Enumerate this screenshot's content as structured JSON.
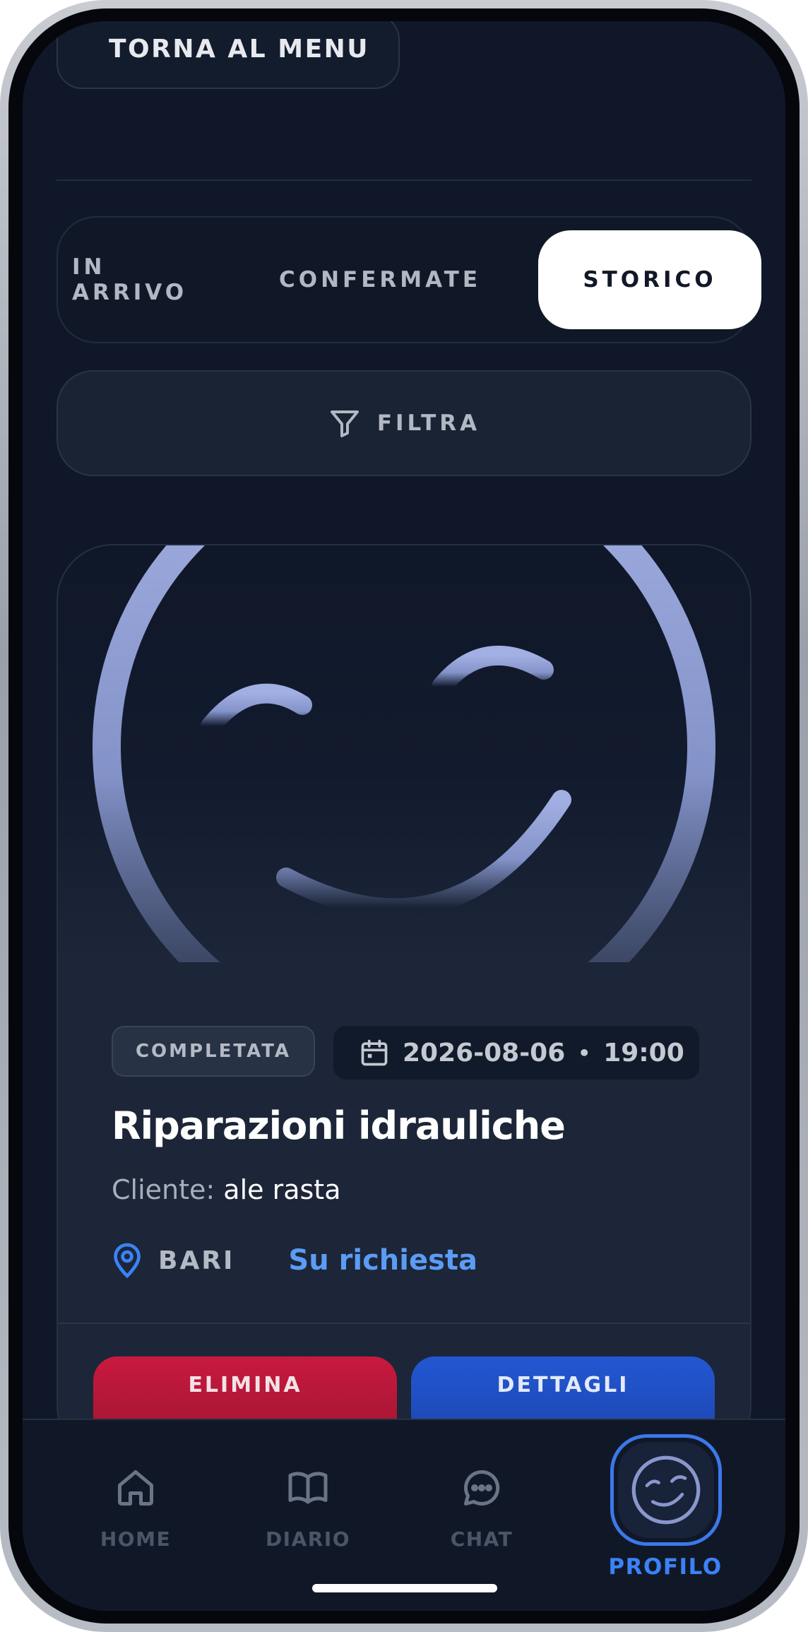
{
  "header": {
    "back_label": "TORNA AL MENU"
  },
  "tabs": [
    {
      "label": "IN ARRIVO",
      "active": false
    },
    {
      "label": "CONFERMATE",
      "active": false
    },
    {
      "label": "STORICO",
      "active": true
    }
  ],
  "filter": {
    "label": "FILTRA",
    "icon": "filter-icon"
  },
  "card": {
    "status": "COMPLETATA",
    "date": "2026-08-06",
    "time": "19:00",
    "separator": "•",
    "title": "Riparazioni idrauliche",
    "client_label": "Cliente:",
    "client_name": "ale rasta",
    "city": "BARI",
    "price_label": "Su richiesta",
    "delete_label": "ELIMINA",
    "details_label": "DETTAGLI"
  },
  "nav": {
    "items": [
      {
        "label": "HOME",
        "icon": "home-icon"
      },
      {
        "label": "DIARIO",
        "icon": "book-icon"
      },
      {
        "label": "CHAT",
        "icon": "chat-icon"
      },
      {
        "label": "PROFILO",
        "icon": "smiley-icon",
        "active": true
      }
    ]
  },
  "colors": {
    "background": "#0f1729",
    "accent": "#3b82f6",
    "danger": "#c8193f",
    "primary": "#2257d2"
  }
}
